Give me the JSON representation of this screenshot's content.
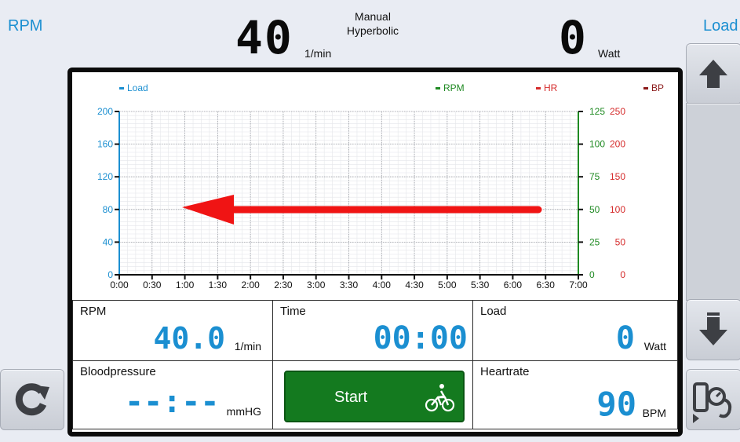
{
  "header": {
    "rpm_label": "RPM",
    "load_label": "Load",
    "rpm_value": "40",
    "rpm_unit": "1/min",
    "mode_line1": "Manual",
    "mode_line2": "Hyperbolic",
    "load_value": "0",
    "load_unit": "Watt"
  },
  "legend": {
    "load": "Load",
    "rpm": "RPM",
    "hr": "HR",
    "bp": "BP"
  },
  "chart": {
    "y_left_ticks": [
      "200",
      "160",
      "120",
      "80",
      "40",
      "0"
    ],
    "y_right_rpm_ticks": [
      "125",
      "100",
      "75",
      "50",
      "25",
      "0"
    ],
    "y_right_other_ticks": [
      "250",
      "200",
      "150",
      "100",
      "50",
      "0"
    ],
    "x_ticks": [
      "0:00",
      "0:30",
      "1:00",
      "1:30",
      "2:00",
      "2:30",
      "3:00",
      "3:30",
      "4:00",
      "4:30",
      "5:00",
      "5:30",
      "6:00",
      "6:30",
      "7:00"
    ],
    "colors": {
      "load": "#1b8fd1",
      "rpm": "#1f8a22",
      "hr": "#d52b2b",
      "bp": "#8b1a1a",
      "arrow": "#f01414"
    }
  },
  "stats": {
    "rpm_title": "RPM",
    "rpm_value": "40.0",
    "rpm_unit": "1/min",
    "time_title": "Time",
    "time_value": "00:00",
    "load_title": "Load",
    "load_value": "0",
    "load_unit": "Watt",
    "bp_title": "Bloodpressure",
    "bp_value": "--:--",
    "bp_unit": "mmHG",
    "start_label": "Start",
    "hr_title": "Heartrate",
    "hr_value": "90",
    "hr_unit": "BPM"
  },
  "icons": {
    "up": "arrow-up-icon",
    "down": "arrow-down-icon",
    "refresh": "refresh-icon",
    "bp_cuff": "blood-pressure-cuff-icon",
    "bike": "cyclist-icon"
  }
}
